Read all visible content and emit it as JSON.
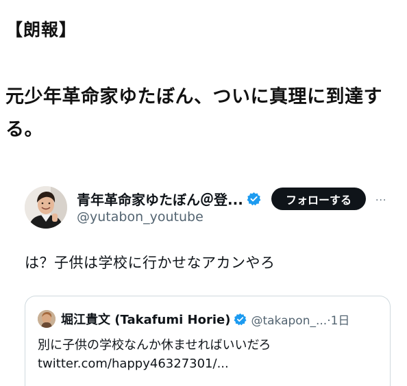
{
  "headline_tag": "【朗報】",
  "headline": "元少年革命家ゆたぼん、ついに真理に到達する。",
  "tweet": {
    "display_name": "青年革命家ゆたぼん＠登...",
    "handle": "@yutabon_youtube",
    "follow_label": "フォローする",
    "more_label": "···",
    "text": "は？子供は学校に行かせなアカンやろ",
    "verified_icon": "verified-badge-icon"
  },
  "quote": {
    "display_name": "堀江貴文 (Takafumi Horie)",
    "handle_time": "@takapon_...·1日",
    "text": "別に子供の学校なんか休ませればいいだろ",
    "link": "twitter.com/happy46327301/..."
  },
  "colors": {
    "text_primary": "#0f1419",
    "text_secondary": "#536471",
    "verified_blue": "#1d9bf0",
    "border": "#cfd9de",
    "follow_button_bg": "#0f1419"
  }
}
